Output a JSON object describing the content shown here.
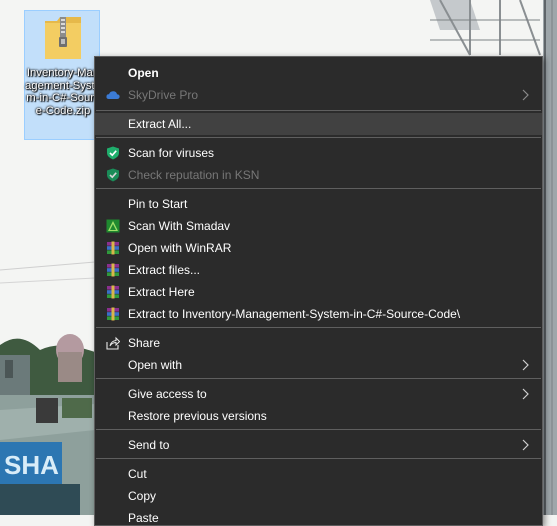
{
  "desktop": {
    "file": {
      "label": "Inventory-Management-System-in-C#-Source-Code.zip",
      "label_display": "Inventory-Management-System-in-C#-Source-Code.zip"
    }
  },
  "menu": {
    "items": [
      {
        "label": "Open",
        "style": "bold",
        "icon": "none"
      },
      {
        "label": "SkyDrive Pro",
        "state": "disabled",
        "icon": "cloud-icon",
        "submenu": true
      },
      {
        "label": "Extract All...",
        "state": "highlighted",
        "icon": "none"
      },
      {
        "label": "Scan for viruses",
        "icon": "kaspersky-shield-icon"
      },
      {
        "label": "Check reputation in KSN",
        "state": "disabled",
        "icon": "kaspersky-shield-icon"
      },
      {
        "label": "Pin to Start",
        "icon": "none"
      },
      {
        "label": "Scan With Smadav",
        "icon": "smadav-icon"
      },
      {
        "label": "Open with WinRAR",
        "icon": "winrar-icon"
      },
      {
        "label": "Extract files...",
        "icon": "winrar-icon"
      },
      {
        "label": "Extract Here",
        "icon": "winrar-icon"
      },
      {
        "label": "Extract to Inventory-Management-System-in-C#-Source-Code\\",
        "icon": "winrar-icon"
      },
      {
        "label": "Share",
        "icon": "share-icon"
      },
      {
        "label": "Open with",
        "icon": "none",
        "submenu": true
      },
      {
        "label": "Give access to",
        "icon": "none",
        "submenu": true
      },
      {
        "label": "Restore previous versions",
        "icon": "none"
      },
      {
        "label": "Send to",
        "icon": "none",
        "submenu": true
      },
      {
        "label": "Cut",
        "icon": "none"
      },
      {
        "label": "Copy",
        "icon": "none"
      },
      {
        "label": "Paste",
        "icon": "none"
      }
    ]
  },
  "colors": {
    "menu_bg": "#2b2b2b",
    "menu_highlight": "#414141",
    "menu_separator": "#5f5f5f",
    "disabled_text": "#777777",
    "selection_blue": "#99ccff",
    "kaspersky_green": "#1fae6c"
  }
}
